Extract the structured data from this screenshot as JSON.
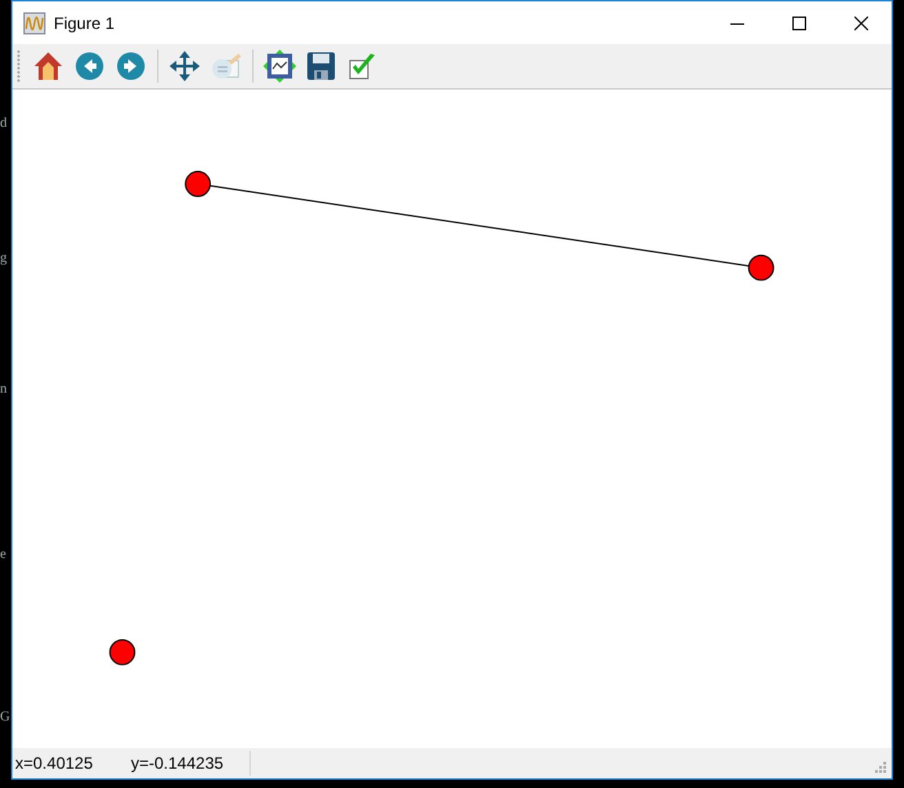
{
  "background_letters": [
    "d",
    "g",
    "n",
    "e",
    "G"
  ],
  "window": {
    "title": "Figure 1"
  },
  "toolbar": [
    {
      "kind": "home",
      "disabled": false
    },
    {
      "kind": "back",
      "disabled": false
    },
    {
      "kind": "forward",
      "disabled": false
    },
    {
      "kind": "separator"
    },
    {
      "kind": "pan",
      "disabled": false
    },
    {
      "kind": "zoom",
      "disabled": true
    },
    {
      "kind": "separator"
    },
    {
      "kind": "subplots",
      "disabled": false
    },
    {
      "kind": "save",
      "disabled": false
    },
    {
      "kind": "customize",
      "disabled": false
    }
  ],
  "status_bar": {
    "x_reading": "x=0.40125",
    "y_reading": "y=-0.144235"
  }
}
